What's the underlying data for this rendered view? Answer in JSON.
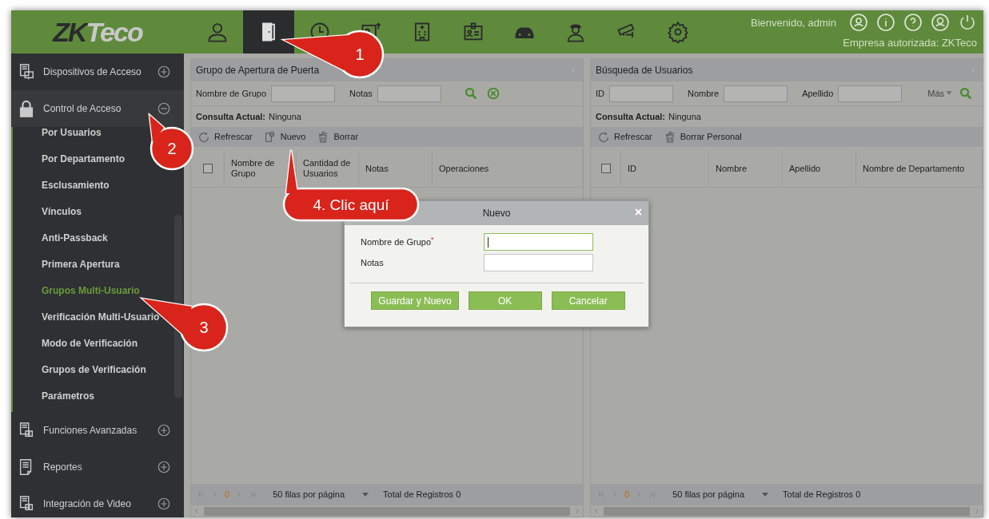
{
  "header": {
    "logo_parts": [
      "ZK",
      "Teco"
    ],
    "nav": [
      {
        "selected": false
      },
      {
        "selected": true
      },
      {
        "selected": false
      },
      {
        "selected": false
      },
      {
        "selected": false
      },
      {
        "selected": false
      },
      {
        "selected": false
      },
      {
        "selected": false
      },
      {
        "selected": false
      },
      {
        "selected": false
      }
    ],
    "greeting": "Bienvenido, admin",
    "company": "Empresa autorizada: ZKTeco"
  },
  "sidebar": {
    "items": [
      {
        "label": "Dispositivos de Acceso",
        "expanded": false
      },
      {
        "label": "Control de Acceso",
        "expanded": true,
        "children": [
          {
            "label": "Por Usuarios",
            "selected": false
          },
          {
            "label": "Por Departamento",
            "selected": false
          },
          {
            "label": "Esclusamiento",
            "selected": false
          },
          {
            "label": "Vínculos",
            "selected": false
          },
          {
            "label": "Anti-Passback",
            "selected": false
          },
          {
            "label": "Primera Apertura",
            "selected": false
          },
          {
            "label": "Grupos Multi-Usuario",
            "selected": true
          },
          {
            "label": "Verificación Multi-Usuario",
            "selected": false
          },
          {
            "label": "Modo de Verificación",
            "selected": false
          },
          {
            "label": "Grupos de Verificación",
            "selected": false
          },
          {
            "label": "Parámetros",
            "selected": false
          }
        ]
      },
      {
        "label": "Funciones Avanzadas",
        "expanded": false
      },
      {
        "label": "Reportes",
        "expanded": false
      },
      {
        "label": "Integración de Video",
        "expanded": false
      }
    ]
  },
  "panels": [
    {
      "title": "Grupo de Apertura de Puerta",
      "filters": [
        {
          "label": "Nombre de Grupo"
        },
        {
          "label": "Notas"
        }
      ],
      "actions": [
        {
          "kind": "search"
        },
        {
          "kind": "clear"
        }
      ],
      "select_all_checked": false,
      "query_label": "Consulta Actual:",
      "query_value": "Ninguna",
      "toolbar": [
        {
          "label": "Refrescar",
          "kind": "refresh"
        },
        {
          "label": "Nuevo",
          "kind": "add"
        },
        {
          "label": "Borrar",
          "kind": "delete"
        }
      ],
      "columns": [
        "Nombre de Grupo",
        "Cantidad de Usuarios",
        "Notas",
        "Operaciones"
      ],
      "pager": {
        "page": "0",
        "page_size": "50 filas por página",
        "total": "Total de Registros 0"
      }
    },
    {
      "title": "Búsqueda de Usuarios",
      "filters": [
        {
          "label": "ID"
        },
        {
          "label": "Nombre"
        },
        {
          "label": "Apellido"
        }
      ],
      "more": "Más",
      "actions": [
        {
          "kind": "search"
        }
      ],
      "select_all_checked": false,
      "query_label": "Consulta Actual:",
      "query_value": "Ninguna",
      "toolbar": [
        {
          "label": "Refrescar",
          "kind": "refresh"
        },
        {
          "label": "Borrar Personal",
          "kind": "delete"
        }
      ],
      "columns": [
        "ID",
        "Nombre",
        "Apellido",
        "Nombre de Departamento"
      ],
      "pager": {
        "page": "0",
        "page_size": "50 filas por página",
        "total": "Total de Registros 0"
      }
    }
  ],
  "dialog": {
    "title": "Nuevo",
    "close": "×",
    "fields": [
      {
        "label": "Nombre de Grupo$^{*}$",
        "focused": true
      },
      {
        "label": "Notas",
        "focused": false
      }
    ],
    "buttons": [
      "Guardar y Nuevo",
      "OK",
      "Cancelar"
    ]
  },
  "callouts": [
    "1",
    "2",
    "3",
    "4. Clic aquí"
  ]
}
